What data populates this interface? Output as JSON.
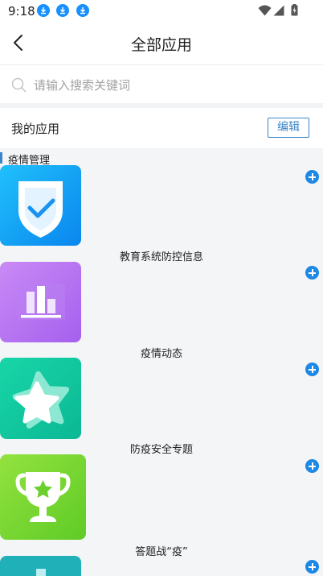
{
  "status_bar": {
    "time": "9:18"
  },
  "header": {
    "title": "全部应用"
  },
  "search": {
    "placeholder": "请输入搜索关键词"
  },
  "my_apps": {
    "label": "我的应用",
    "edit_label": "编辑"
  },
  "section": {
    "title": "疫情管理"
  },
  "apps": [
    {
      "name": "教育系统防控信息",
      "icon": "shield-check-icon",
      "color": "#1aa0f5"
    },
    {
      "name": "疫情动态",
      "icon": "bar-chart-icon",
      "color": "#b76ef0"
    },
    {
      "name": "防疫安全专题",
      "icon": "star-icon",
      "color": "#12c8a0"
    },
    {
      "name": "答题战“疫”",
      "icon": "trophy-icon",
      "color": "#6fd42e"
    },
    {
      "name": "",
      "icon": "app-icon",
      "color": "#1fb0b8"
    }
  ],
  "colors": {
    "accent": "#3a86c8",
    "add": "#1e88e5"
  }
}
